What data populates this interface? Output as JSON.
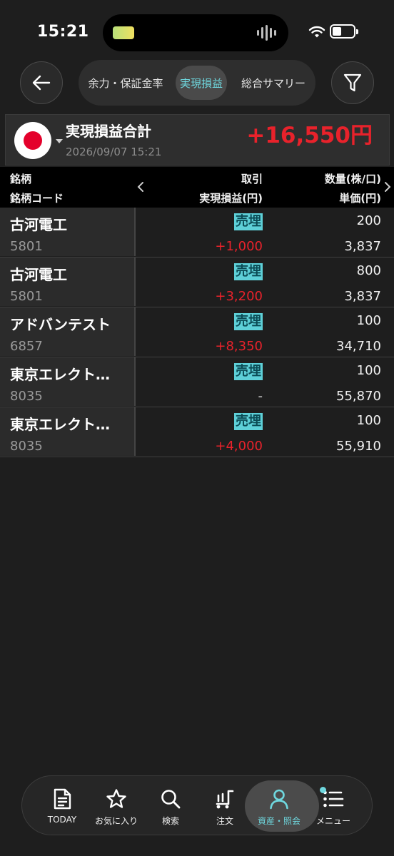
{
  "status_bar": {
    "time": "15:21"
  },
  "nav": {
    "tabs": [
      {
        "label": "余力・保証金率"
      },
      {
        "label": "実現損益"
      },
      {
        "label": "総合サマリー"
      }
    ]
  },
  "summary": {
    "title": "実現損益合計",
    "date": "2026/09/07 15:21",
    "total": "+16,550円"
  },
  "table": {
    "headers": {
      "name": "銘柄",
      "code": "銘柄コード",
      "trade": "取引",
      "pl": "実現損益(円)",
      "qty": "数量(株/口)",
      "price": "単価(円)"
    },
    "rows": [
      {
        "name": "古河電工",
        "code": "5801",
        "trade": "売埋",
        "pl": "+1,000",
        "qty": "200",
        "price": "3,837"
      },
      {
        "name": "古河電工",
        "code": "5801",
        "trade": "売埋",
        "pl": "+3,200",
        "qty": "800",
        "price": "3,837"
      },
      {
        "name": "アドバンテスト",
        "code": "6857",
        "trade": "売埋",
        "pl": "+8,350",
        "qty": "100",
        "price": "34,710"
      },
      {
        "name": "東京エレクト…",
        "code": "8035",
        "trade": "売埋",
        "pl": "-",
        "qty": "100",
        "price": "55,870"
      },
      {
        "name": "東京エレクト…",
        "code": "8035",
        "trade": "売埋",
        "pl": "+4,000",
        "qty": "100",
        "price": "55,910"
      }
    ]
  },
  "tabbar": {
    "items": [
      {
        "label": "TODAY"
      },
      {
        "label": "お気に入り"
      },
      {
        "label": "検索"
      },
      {
        "label": "注文"
      },
      {
        "label": "資産・照会"
      },
      {
        "label": "メニュー"
      }
    ]
  },
  "colors": {
    "accent": "#6fd8df",
    "profit": "#e8222b",
    "background": "#1e1e1e"
  }
}
